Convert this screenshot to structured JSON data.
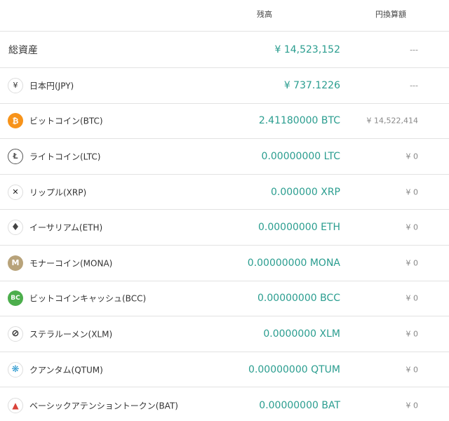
{
  "header": {
    "balance_label": "残高",
    "jpy_label": "円換算額"
  },
  "rows": [
    {
      "name": "総資産",
      "balance": "¥ 14,523,152",
      "jpy": "---",
      "icon": "",
      "icon_color": ""
    },
    {
      "name": "日本円(JPY)",
      "balance": "¥ 737.1226",
      "jpy": "---",
      "icon": "yen-icon",
      "glyph": "¥"
    },
    {
      "name": "ビットコイン(BTC)",
      "balance": "2.41180000  BTC",
      "jpy": "¥ 14,522,414",
      "icon": "bitcoin-icon",
      "glyph": "₿"
    },
    {
      "name": "ライトコイン(LTC)",
      "balance": "0.00000000  LTC",
      "jpy": "¥ 0",
      "icon": "litecoin-icon",
      "glyph": "Ł"
    },
    {
      "name": "リップル(XRP)",
      "balance": "0.000000  XRP",
      "jpy": "¥ 0",
      "icon": "ripple-icon",
      "glyph": "✕"
    },
    {
      "name": "イーサリアム(ETH)",
      "balance": "0.00000000  ETH",
      "jpy": "¥ 0",
      "icon": "ethereum-icon",
      "glyph": "♦"
    },
    {
      "name": "モナーコイン(MONA)",
      "balance": "0.00000000  MONA",
      "jpy": "¥ 0",
      "icon": "monacoin-icon",
      "glyph": "M"
    },
    {
      "name": "ビットコインキャッシュ(BCC)",
      "balance": "0.00000000  BCC",
      "jpy": "¥ 0",
      "icon": "bitcoin-cash-icon",
      "glyph": "BC"
    },
    {
      "name": "ステラルーメン(XLM)",
      "balance": "0.0000000  XLM",
      "jpy": "¥ 0",
      "icon": "stellar-icon",
      "glyph": "⊘"
    },
    {
      "name": "クアンタム(QTUM)",
      "balance": "0.00000000  QTUM",
      "jpy": "¥ 0",
      "icon": "qtum-icon",
      "glyph": "❋"
    },
    {
      "name": "ベーシックアテンショントークン(BAT)",
      "balance": "0.00000000  BAT",
      "jpy": "¥ 0",
      "icon": "bat-icon",
      "glyph": "▲"
    }
  ],
  "colors": {
    "accent_teal": "#2a9d8f",
    "btc_orange": "#f7931a",
    "bcc_green": "#4cae4c",
    "mona_tan": "#b8a37a",
    "bat_red": "#d9433a",
    "qtum_blue": "#2e9ad0"
  }
}
